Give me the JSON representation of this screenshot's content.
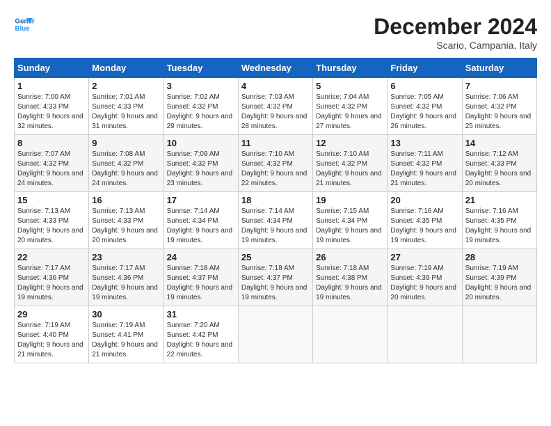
{
  "header": {
    "logo_line1": "General",
    "logo_line2": "Blue",
    "month_title": "December 2024",
    "subtitle": "Scario, Campania, Italy"
  },
  "weekdays": [
    "Sunday",
    "Monday",
    "Tuesday",
    "Wednesday",
    "Thursday",
    "Friday",
    "Saturday"
  ],
  "weeks": [
    [
      {
        "day": "1",
        "info": "Sunrise: 7:00 AM\nSunset: 4:33 PM\nDaylight: 9 hours and 32 minutes."
      },
      {
        "day": "2",
        "info": "Sunrise: 7:01 AM\nSunset: 4:33 PM\nDaylight: 9 hours and 31 minutes."
      },
      {
        "day": "3",
        "info": "Sunrise: 7:02 AM\nSunset: 4:32 PM\nDaylight: 9 hours and 29 minutes."
      },
      {
        "day": "4",
        "info": "Sunrise: 7:03 AM\nSunset: 4:32 PM\nDaylight: 9 hours and 28 minutes."
      },
      {
        "day": "5",
        "info": "Sunrise: 7:04 AM\nSunset: 4:32 PM\nDaylight: 9 hours and 27 minutes."
      },
      {
        "day": "6",
        "info": "Sunrise: 7:05 AM\nSunset: 4:32 PM\nDaylight: 9 hours and 26 minutes."
      },
      {
        "day": "7",
        "info": "Sunrise: 7:06 AM\nSunset: 4:32 PM\nDaylight: 9 hours and 25 minutes."
      }
    ],
    [
      {
        "day": "8",
        "info": "Sunrise: 7:07 AM\nSunset: 4:32 PM\nDaylight: 9 hours and 24 minutes."
      },
      {
        "day": "9",
        "info": "Sunrise: 7:08 AM\nSunset: 4:32 PM\nDaylight: 9 hours and 24 minutes."
      },
      {
        "day": "10",
        "info": "Sunrise: 7:09 AM\nSunset: 4:32 PM\nDaylight: 9 hours and 23 minutes."
      },
      {
        "day": "11",
        "info": "Sunrise: 7:10 AM\nSunset: 4:32 PM\nDaylight: 9 hours and 22 minutes."
      },
      {
        "day": "12",
        "info": "Sunrise: 7:10 AM\nSunset: 4:32 PM\nDaylight: 9 hours and 21 minutes."
      },
      {
        "day": "13",
        "info": "Sunrise: 7:11 AM\nSunset: 4:32 PM\nDaylight: 9 hours and 21 minutes."
      },
      {
        "day": "14",
        "info": "Sunrise: 7:12 AM\nSunset: 4:33 PM\nDaylight: 9 hours and 20 minutes."
      }
    ],
    [
      {
        "day": "15",
        "info": "Sunrise: 7:13 AM\nSunset: 4:33 PM\nDaylight: 9 hours and 20 minutes."
      },
      {
        "day": "16",
        "info": "Sunrise: 7:13 AM\nSunset: 4:33 PM\nDaylight: 9 hours and 20 minutes."
      },
      {
        "day": "17",
        "info": "Sunrise: 7:14 AM\nSunset: 4:34 PM\nDaylight: 9 hours and 19 minutes."
      },
      {
        "day": "18",
        "info": "Sunrise: 7:14 AM\nSunset: 4:34 PM\nDaylight: 9 hours and 19 minutes."
      },
      {
        "day": "19",
        "info": "Sunrise: 7:15 AM\nSunset: 4:34 PM\nDaylight: 9 hours and 19 minutes."
      },
      {
        "day": "20",
        "info": "Sunrise: 7:16 AM\nSunset: 4:35 PM\nDaylight: 9 hours and 19 minutes."
      },
      {
        "day": "21",
        "info": "Sunrise: 7:16 AM\nSunset: 4:35 PM\nDaylight: 9 hours and 19 minutes."
      }
    ],
    [
      {
        "day": "22",
        "info": "Sunrise: 7:17 AM\nSunset: 4:36 PM\nDaylight: 9 hours and 19 minutes."
      },
      {
        "day": "23",
        "info": "Sunrise: 7:17 AM\nSunset: 4:36 PM\nDaylight: 9 hours and 19 minutes."
      },
      {
        "day": "24",
        "info": "Sunrise: 7:18 AM\nSunset: 4:37 PM\nDaylight: 9 hours and 19 minutes."
      },
      {
        "day": "25",
        "info": "Sunrise: 7:18 AM\nSunset: 4:37 PM\nDaylight: 9 hours and 19 minutes."
      },
      {
        "day": "26",
        "info": "Sunrise: 7:18 AM\nSunset: 4:38 PM\nDaylight: 9 hours and 19 minutes."
      },
      {
        "day": "27",
        "info": "Sunrise: 7:19 AM\nSunset: 4:39 PM\nDaylight: 9 hours and 20 minutes."
      },
      {
        "day": "28",
        "info": "Sunrise: 7:19 AM\nSunset: 4:39 PM\nDaylight: 9 hours and 20 minutes."
      }
    ],
    [
      {
        "day": "29",
        "info": "Sunrise: 7:19 AM\nSunset: 4:40 PM\nDaylight: 9 hours and 21 minutes."
      },
      {
        "day": "30",
        "info": "Sunrise: 7:19 AM\nSunset: 4:41 PM\nDaylight: 9 hours and 21 minutes."
      },
      {
        "day": "31",
        "info": "Sunrise: 7:20 AM\nSunset: 4:42 PM\nDaylight: 9 hours and 22 minutes."
      },
      null,
      null,
      null,
      null
    ]
  ]
}
